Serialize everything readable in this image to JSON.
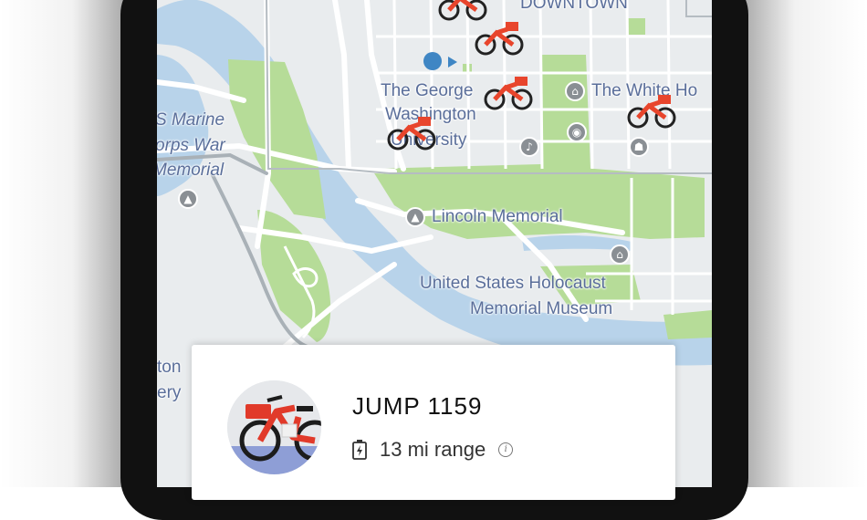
{
  "map": {
    "labels": {
      "downtown": "DOWNTOWN",
      "gwu_line1": "The George",
      "gwu_line2": "Washington",
      "gwu_line3": "University",
      "white_house": "The White Ho",
      "marine_line1": "S Marine",
      "marine_line2": "orps War",
      "marine_line3": "Memorial",
      "lincoln": "Lincoln Memorial",
      "holocaust_line1": "United States Holocaust",
      "holocaust_line2": "Memorial Museum",
      "arlington_line1": "ton",
      "arlington_line2": "ery"
    },
    "colors": {
      "land": "#e9ecee",
      "water": "#b8d3ea",
      "park": "#b6dc98",
      "road": "#ffffff",
      "bike_accent": "#e8452c",
      "location": "#3f86c4"
    },
    "icons": [
      "bank-icon",
      "camera-icon",
      "music-icon",
      "museum-icon",
      "tree-icon",
      "lincoln-memorial-icon",
      "location-dot-icon"
    ]
  },
  "card": {
    "bike_name": "JUMP 1159",
    "range": "13 mi range",
    "icons": [
      "battery-charging-icon",
      "info-icon"
    ]
  }
}
